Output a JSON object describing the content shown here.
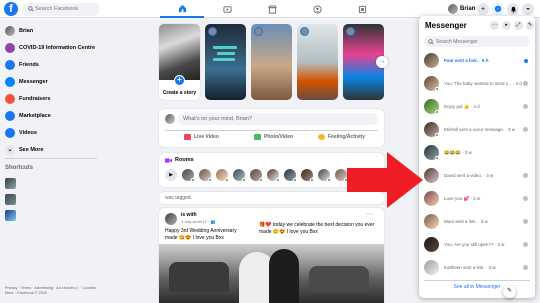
{
  "topbar": {
    "logo": "f",
    "search_placeholder": "Search Facebook",
    "profile_name": "Brian",
    "nav_icons": [
      "home-icon",
      "watch-icon",
      "marketplace-icon",
      "groups-icon",
      "gaming-icon"
    ]
  },
  "leftnav": {
    "items": [
      {
        "label": "Brian",
        "icon": "avatar",
        "color": "#777777"
      },
      {
        "label": "COVID-19 Information Centre",
        "icon": "covid-icon",
        "color": "#8e44ad"
      },
      {
        "label": "Friends",
        "icon": "friends-icon",
        "color": "#1877f2"
      },
      {
        "label": "Messenger",
        "icon": "messenger-icon",
        "color": "#0084ff"
      },
      {
        "label": "Fundraisers",
        "icon": "fundraisers-icon",
        "color": "#f5533d"
      },
      {
        "label": "Marketplace",
        "icon": "marketplace-icon",
        "color": "#1877f2"
      },
      {
        "label": "Videos",
        "icon": "videos-icon",
        "color": "#1877f2"
      },
      {
        "label": "See More",
        "icon": "chevron-down-icon",
        "color": "#e4e6eb"
      }
    ],
    "shortcuts_title": "Shortcuts",
    "footer": "Privacy · Terms · Advertising · Ad choices ▷ · Cookies · More · Facebook © 2020"
  },
  "stories": {
    "create_label": "Create a story"
  },
  "composer": {
    "placeholder": "What's on your mind, Brian?",
    "buttons": [
      {
        "label": "Live Video",
        "color": "#f3425f"
      },
      {
        "label": "Photo/Video",
        "color": "#45bd62"
      },
      {
        "label": "Feeling/Activity",
        "color": "#f7b928"
      }
    ]
  },
  "rooms": {
    "title": "Rooms"
  },
  "tagged": {
    "text": "was tagged."
  },
  "post": {
    "name": "is with",
    "time": "1 July at 08:17 · 👥",
    "text_left": "Happy 3rd Wedding Anniversary\nmade 😘😍 I love you Bxx",
    "text_right": "🎁❤️ today we celebrate the best decision you ever\nmade 😊😍 I love you Bxx"
  },
  "messenger": {
    "title": "Messenger",
    "search_placeholder": "Search Messenger",
    "conversations": [
      {
        "preview": "Paul sent a link. · 6 h",
        "unread": true,
        "status": "unread"
      },
      {
        "preview": "You: The baby wanted to send y... · 4 d",
        "unread": false,
        "status": "seen"
      },
      {
        "preview": "Enjoy pal 👍 · 4 d",
        "unread": false,
        "status": "seen"
      },
      {
        "preview": "Michell sent a voice message. · 3 w",
        "unread": false,
        "status": "seen"
      },
      {
        "preview": "😂😂😂 · 3 w",
        "unread": false,
        "status": "none"
      },
      {
        "preview": "David sent a video. · 3 w",
        "unread": false,
        "status": "seen"
      },
      {
        "preview": "Love you 💕 · 3 w",
        "unread": false,
        "status": "seen"
      },
      {
        "preview": "Mum sent a link. · 3 w",
        "unread": false,
        "status": "seen"
      },
      {
        "preview": "You: Are you still open?? · 3 w",
        "unread": false,
        "status": "seen"
      },
      {
        "preview": "Kathleen sent a link. · 3 w",
        "unread": false,
        "status": "seen"
      }
    ],
    "footer": "See all in Messenger"
  }
}
